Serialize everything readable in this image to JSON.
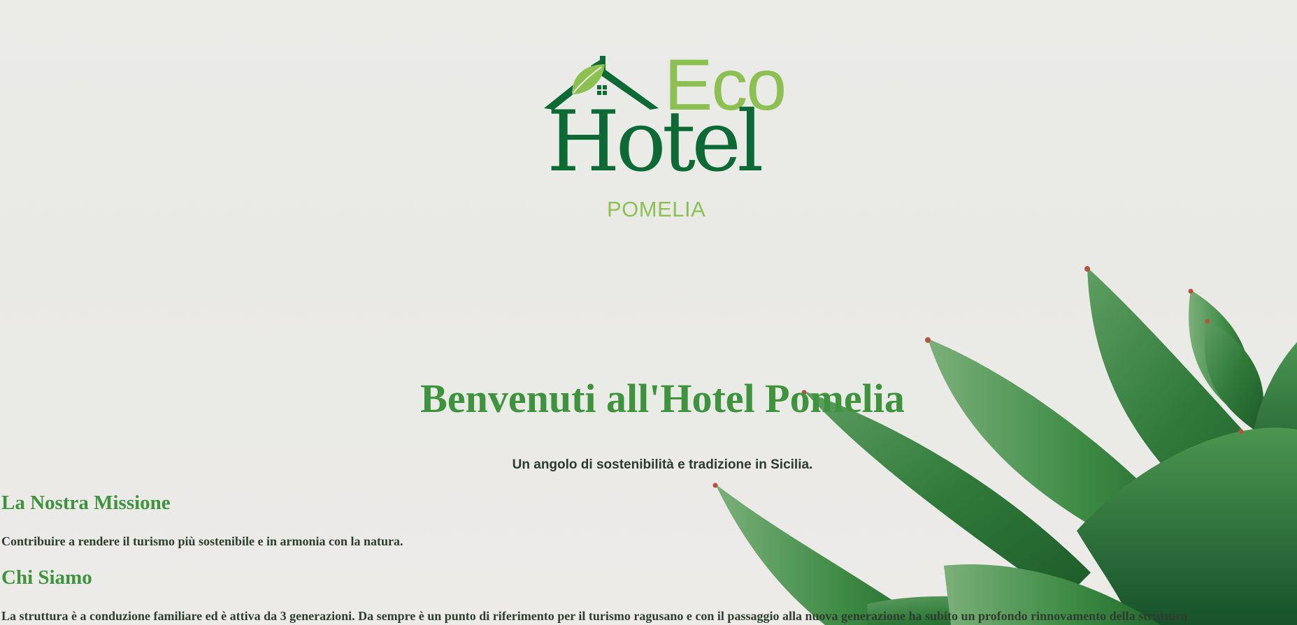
{
  "logo": {
    "eco": "Eco",
    "hotel": "Hotel",
    "pomelia": "POMELIA",
    "colors": {
      "dark_green": "#0c6b35",
      "light_green": "#8cc152"
    },
    "icon": "house-leaf-icon"
  },
  "hero": {
    "title": "Benvenuti all'Hotel Pomelia",
    "tagline": "Un angolo di sostenibilità e tradizione in Sicilia."
  },
  "sections": {
    "mission": {
      "heading": "La Nostra Missione",
      "text": "Contribuire a rendere il turismo più sostenibile e in armonia con la natura."
    },
    "about": {
      "heading": "Chi Siamo",
      "text": "La struttura è a conduzione familiare ed è attiva da 3 generazioni. Da sempre è un punto di riferimento per il turismo ragusano e con il passaggio alla nuova generazione ha subito un profondo rinnovamento della struttura"
    }
  },
  "background": {
    "image": "succulent-plant",
    "colors": {
      "accent": "#3d943d",
      "text": "#2f3d2f",
      "background": "#ebebe8"
    }
  }
}
